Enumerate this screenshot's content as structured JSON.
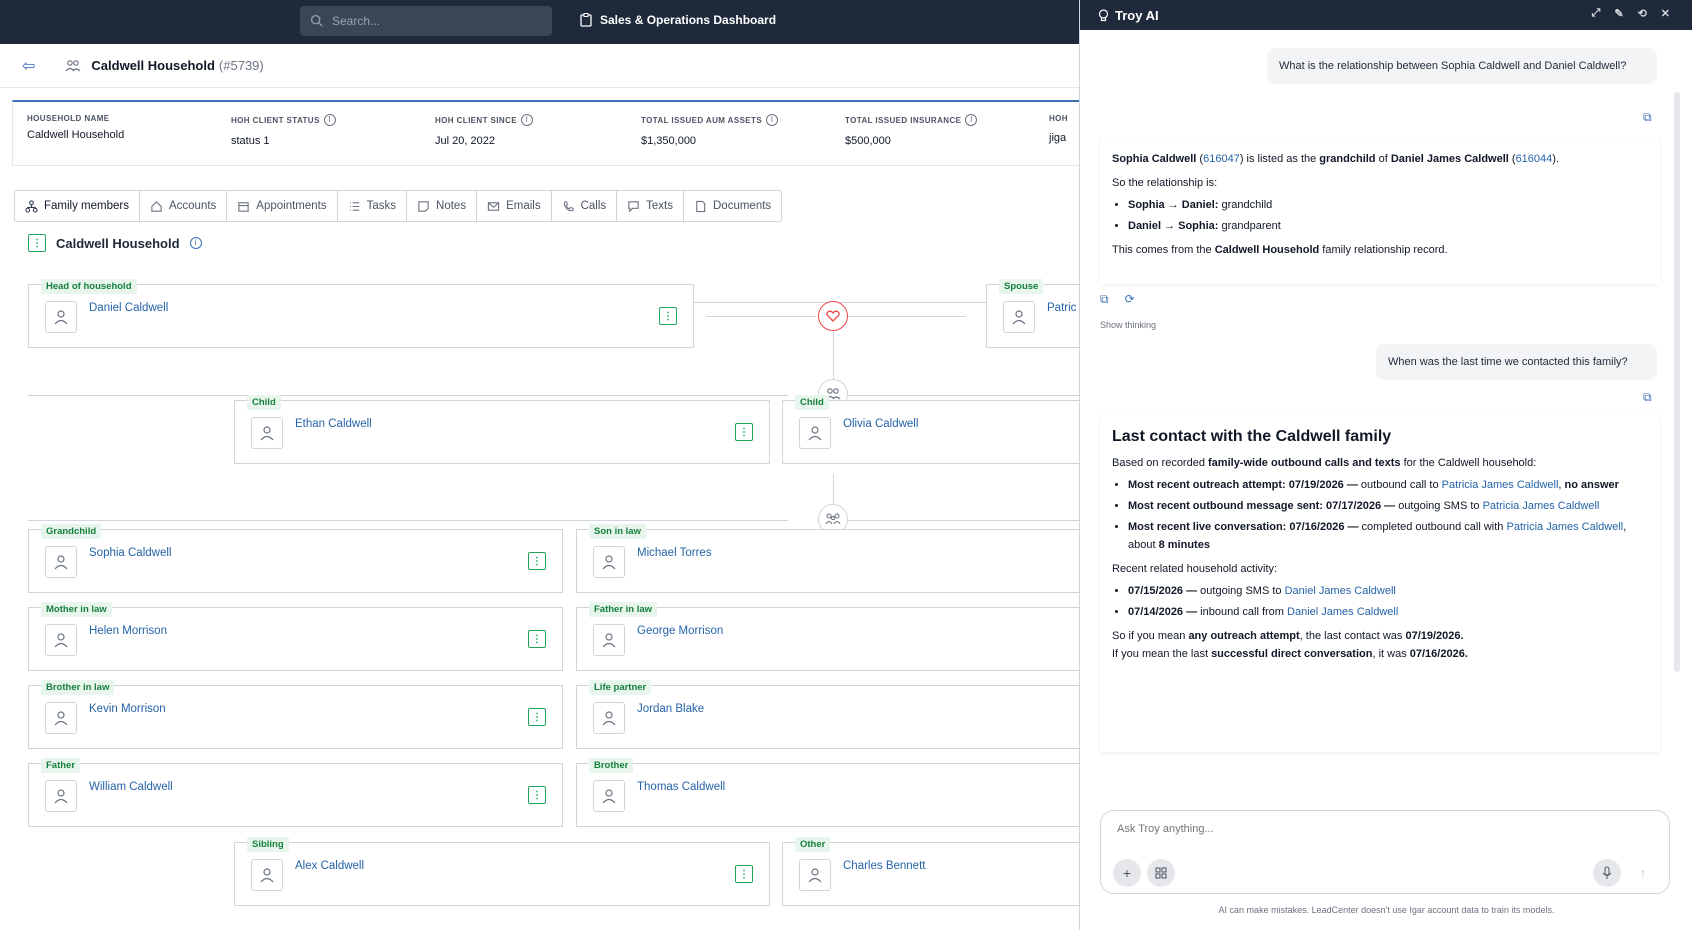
{
  "topbar": {
    "search_placeholder": "Search...",
    "title": "Sales & Operations Dashboard"
  },
  "household": {
    "name": "Caldwell Household",
    "id": "(#5739)"
  },
  "summary": [
    {
      "label": "Household name",
      "value": "Caldwell Household",
      "info": false
    },
    {
      "label": "HOH Client Status",
      "value": "status 1",
      "info": true
    },
    {
      "label": "HOH Client Since",
      "value": "Jul 20, 2022",
      "info": true
    },
    {
      "label": "Total Issued AUM Assets",
      "value": "$1,350,000",
      "info": true
    },
    {
      "label": "Total Issued Insurance",
      "value": "$500,000",
      "info": true
    },
    {
      "label": "HOH",
      "value": "jiga",
      "info": false
    }
  ],
  "tabs": [
    "Family members",
    "Accounts",
    "Appointments",
    "Tasks",
    "Notes",
    "Emails",
    "Calls",
    "Texts",
    "Documents"
  ],
  "section_title": "Caldwell Household",
  "members": {
    "hoh": {
      "role": "Head of household",
      "name": "Daniel Caldwell"
    },
    "spouse": {
      "role": "Spouse",
      "name": "Patric"
    },
    "child1": {
      "role": "Child",
      "name": "Ethan Caldwell"
    },
    "child2": {
      "role": "Child",
      "name": "Olivia Caldwell"
    },
    "grandchild": {
      "role": "Grandchild",
      "name": "Sophia Caldwell"
    },
    "son_in_law": {
      "role": "Son in law",
      "name": "Michael Torres"
    },
    "mother_in_law": {
      "role": "Mother in law",
      "name": "Helen Morrison"
    },
    "father_in_law": {
      "role": "Father in law",
      "name": "George Morrison"
    },
    "brother_in_law": {
      "role": "Brother in law",
      "name": "Kevin Morrison"
    },
    "life_partner": {
      "role": "Life partner",
      "name": "Jordan Blake"
    },
    "father": {
      "role": "Father",
      "name": "William Caldwell"
    },
    "brother": {
      "role": "Brother",
      "name": "Thomas Caldwell"
    },
    "sibling": {
      "role": "Sibling",
      "name": "Alex Caldwell"
    },
    "other": {
      "role": "Other",
      "name": "Charles Bennett"
    }
  },
  "panel": {
    "title": "Troy AI",
    "q1": "What is the relationship between Sophia Caldwell and Daniel Caldwell?",
    "a1": {
      "sophia": "Sophia Caldwell",
      "sophia_id": "616047",
      "listed_as": ") is listed as the ",
      "grandchild": "grandchild",
      "of": " of ",
      "daniel": "Daniel James Caldwell",
      "daniel_id": "616044",
      "so": "So the relationship is:",
      "b1_label": "Sophia → Daniel:",
      "b1_val": " grandchild",
      "b2_label": "Daniel → Sophia:",
      "b2_val": " grandparent",
      "comes_from": "This comes from the ",
      "record_bold": "Caldwell Household",
      "record_rest": " family relationship record."
    },
    "show_thinking": "Show thinking",
    "q2": "When was the last time we contacted this family?",
    "a2": {
      "heading": "Last contact with the Caldwell family",
      "intro_pre": "Based on recorded ",
      "intro_bold": "family-wide outbound calls and texts",
      "intro_post": " for the Caldwell household:",
      "i1_bold": "Most recent outreach attempt: 07/19/2026 —",
      "i1_text": " outbound call to ",
      "i1_link": "Patricia James Caldwell",
      "i1_tail": ", ",
      "i1_tail_bold": "no answer",
      "i2_bold": "Most recent outbound message sent: 07/17/2026 —",
      "i2_text": " outgoing SMS to ",
      "i2_link": "Patricia James Caldwell",
      "i3_bold": "Most recent live conversation: 07/16/2026 —",
      "i3_text": " completed outbound call with ",
      "i3_link": "Patricia James Caldwell",
      "i3_tail": ", about ",
      "i3_tail_bold": "8 minutes",
      "related": "Recent related household activity:",
      "r1_bold": "07/15/2026 —",
      "r1_text": " outgoing SMS to ",
      "r1_link": "Daniel James Caldwell",
      "r2_bold": "07/14/2026 —",
      "r2_text": " inbound call from ",
      "r2_link": "Daniel James Caldwell",
      "c1_pre": "So if you mean ",
      "c1_bold": "any outreach attempt",
      "c1_mid": ", the last contact was ",
      "c1_date": "07/19/2026.",
      "c2_pre": "If you mean the last ",
      "c2_bold": "successful direct conversation",
      "c2_mid": ", it was ",
      "c2_date": "07/16/2026."
    },
    "composer_placeholder": "Ask Troy anything...",
    "disclaimer": "AI can make mistakes. LeadCenter doesn't use Igar account data to train its models."
  }
}
